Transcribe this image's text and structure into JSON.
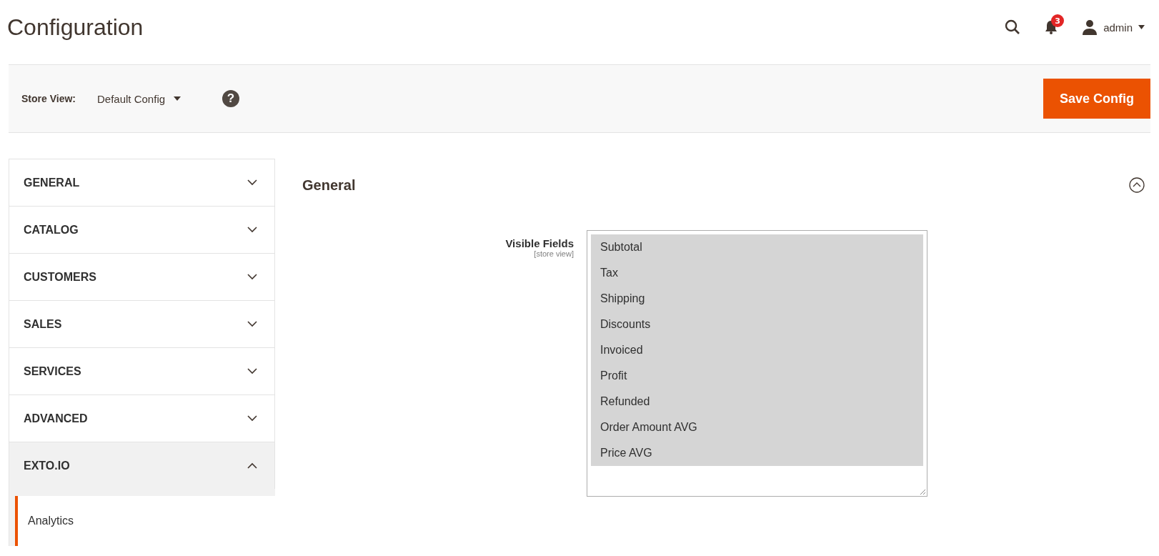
{
  "header": {
    "title": "Configuration",
    "notifications": "3",
    "user": "admin"
  },
  "store_bar": {
    "label": "Store View:",
    "scope": "Default Config",
    "help": "?",
    "save_button": "Save Config"
  },
  "sidebar": {
    "items": [
      {
        "label": "GENERAL",
        "expanded": false
      },
      {
        "label": "CATALOG",
        "expanded": false
      },
      {
        "label": "CUSTOMERS",
        "expanded": false
      },
      {
        "label": "SALES",
        "expanded": false
      },
      {
        "label": "SERVICES",
        "expanded": false
      },
      {
        "label": "ADVANCED",
        "expanded": false
      },
      {
        "label": "EXTO.IO",
        "expanded": true,
        "children": [
          {
            "label": "Analytics",
            "selected": true
          }
        ]
      }
    ]
  },
  "section": {
    "title": "General",
    "expanded": true,
    "field": {
      "label": "Visible Fields",
      "scope": "[store view]",
      "options": [
        {
          "label": "Subtotal",
          "selected": true
        },
        {
          "label": "Tax",
          "selected": true
        },
        {
          "label": "Shipping",
          "selected": true
        },
        {
          "label": "Discounts",
          "selected": true
        },
        {
          "label": "Invoiced",
          "selected": true
        },
        {
          "label": "Profit",
          "selected": true
        },
        {
          "label": "Refunded",
          "selected": true
        },
        {
          "label": "Order Amount AVG",
          "selected": true
        },
        {
          "label": "Price AVG",
          "selected": true
        }
      ]
    }
  }
}
